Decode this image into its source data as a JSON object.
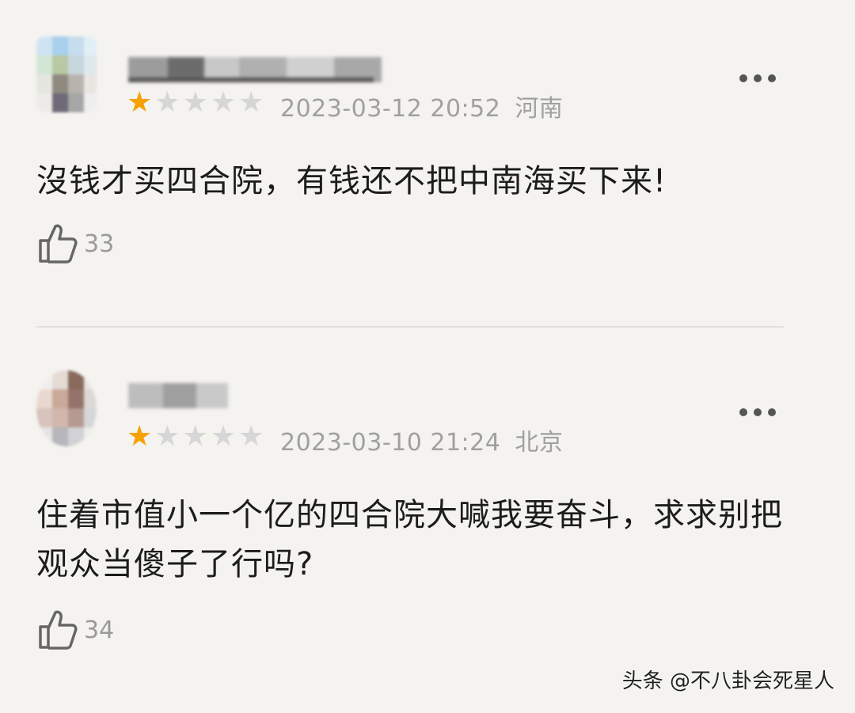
{
  "comments": [
    {
      "rating": 1,
      "max_rating": 5,
      "datetime": "2023-03-12 20:52",
      "location": "河南",
      "text": "沒钱才买四合院，有钱还不把中南海买下来!",
      "likes": "33"
    },
    {
      "rating": 1,
      "max_rating": 5,
      "datetime": "2023-03-10 21:24",
      "location": "北京",
      "text": "住着市值小一个亿的四合院大喊我要奋斗，求求别把观众当傻子了行吗?",
      "likes": "34"
    }
  ],
  "watermark": "头条 @不八卦会死星人",
  "colors": {
    "star_on": "#f5a200",
    "star_off": "#d6d6d6",
    "meta": "#a0a0a0",
    "background": "#f4f3ef"
  },
  "icons": {
    "like": "thumbs-up-icon",
    "more": "more-dots-icon",
    "star": "star-icon"
  }
}
